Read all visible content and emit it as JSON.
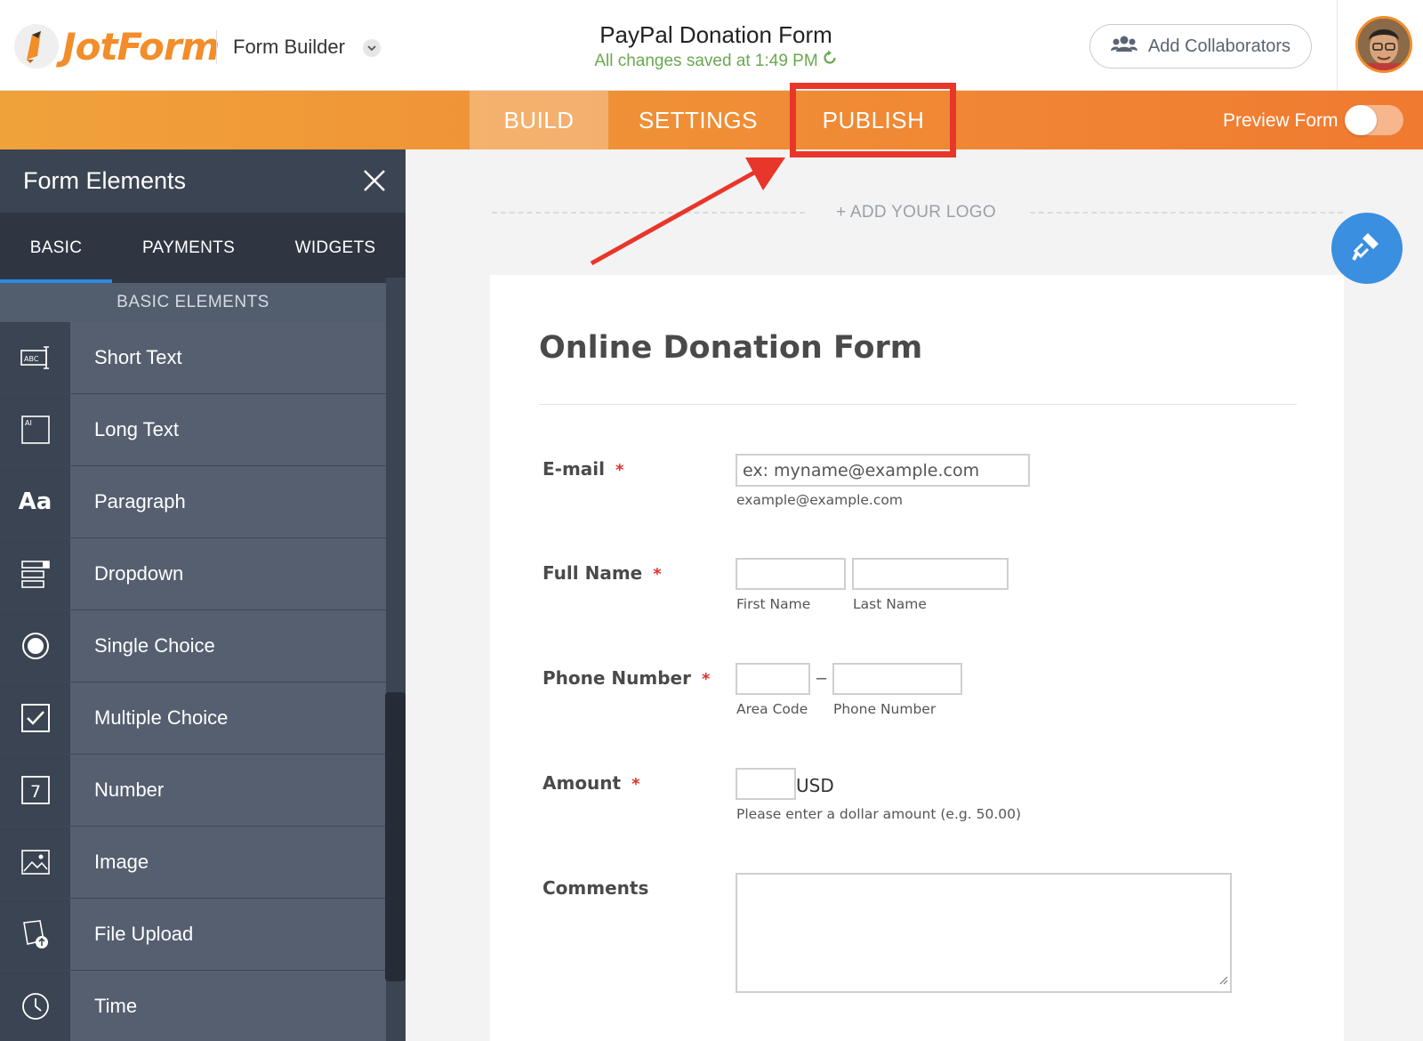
{
  "header": {
    "brand": "JotForm",
    "builder_label": "Form Builder",
    "form_title": "PayPal Donation Form",
    "saved_status": "All changes saved at 1:49 PM",
    "collaborators_label": "Add Collaborators"
  },
  "tabs": {
    "build": "BUILD",
    "settings": "SETTINGS",
    "publish": "PUBLISH",
    "active": "BUILD"
  },
  "preview": {
    "label": "Preview Form",
    "enabled": false
  },
  "sidebar": {
    "title": "Form Elements",
    "tabs": [
      "BASIC",
      "PAYMENTS",
      "WIDGETS"
    ],
    "active_tab": "BASIC",
    "section_label": "BASIC ELEMENTS",
    "items": [
      {
        "label": "Short Text",
        "icon": "short-text-icon"
      },
      {
        "label": "Long Text",
        "icon": "long-text-icon"
      },
      {
        "label": "Paragraph",
        "icon": "paragraph-icon"
      },
      {
        "label": "Dropdown",
        "icon": "dropdown-icon"
      },
      {
        "label": "Single Choice",
        "icon": "single-choice-icon"
      },
      {
        "label": "Multiple Choice",
        "icon": "multiple-choice-icon"
      },
      {
        "label": "Number",
        "icon": "number-icon"
      },
      {
        "label": "Image",
        "icon": "image-icon"
      },
      {
        "label": "File Upload",
        "icon": "file-upload-icon"
      },
      {
        "label": "Time",
        "icon": "time-icon"
      }
    ]
  },
  "canvas": {
    "add_logo": "+ ADD YOUR LOGO"
  },
  "form": {
    "heading": "Online Donation Form",
    "fields": {
      "email": {
        "label": "E-mail",
        "required": "*",
        "placeholder": "ex: myname@example.com",
        "sublabel": "example@example.com"
      },
      "full_name": {
        "label": "Full Name",
        "required": "*",
        "first": "First Name",
        "last": "Last Name"
      },
      "phone": {
        "label": "Phone Number",
        "required": "*",
        "separator": "–",
        "area": "Area Code",
        "number": "Phone Number"
      },
      "amount": {
        "label": "Amount",
        "required": "*",
        "currency": "USD",
        "sublabel": "Please enter a dollar amount (e.g. 50.00)"
      },
      "comments": {
        "label": "Comments"
      }
    }
  },
  "colors": {
    "brand_orange": "#f28d2a",
    "highlight_red": "#e8372a",
    "sidebar_dark": "#3b4452",
    "accent_blue": "#2b8ae2",
    "saved_green": "#6aa84f"
  }
}
